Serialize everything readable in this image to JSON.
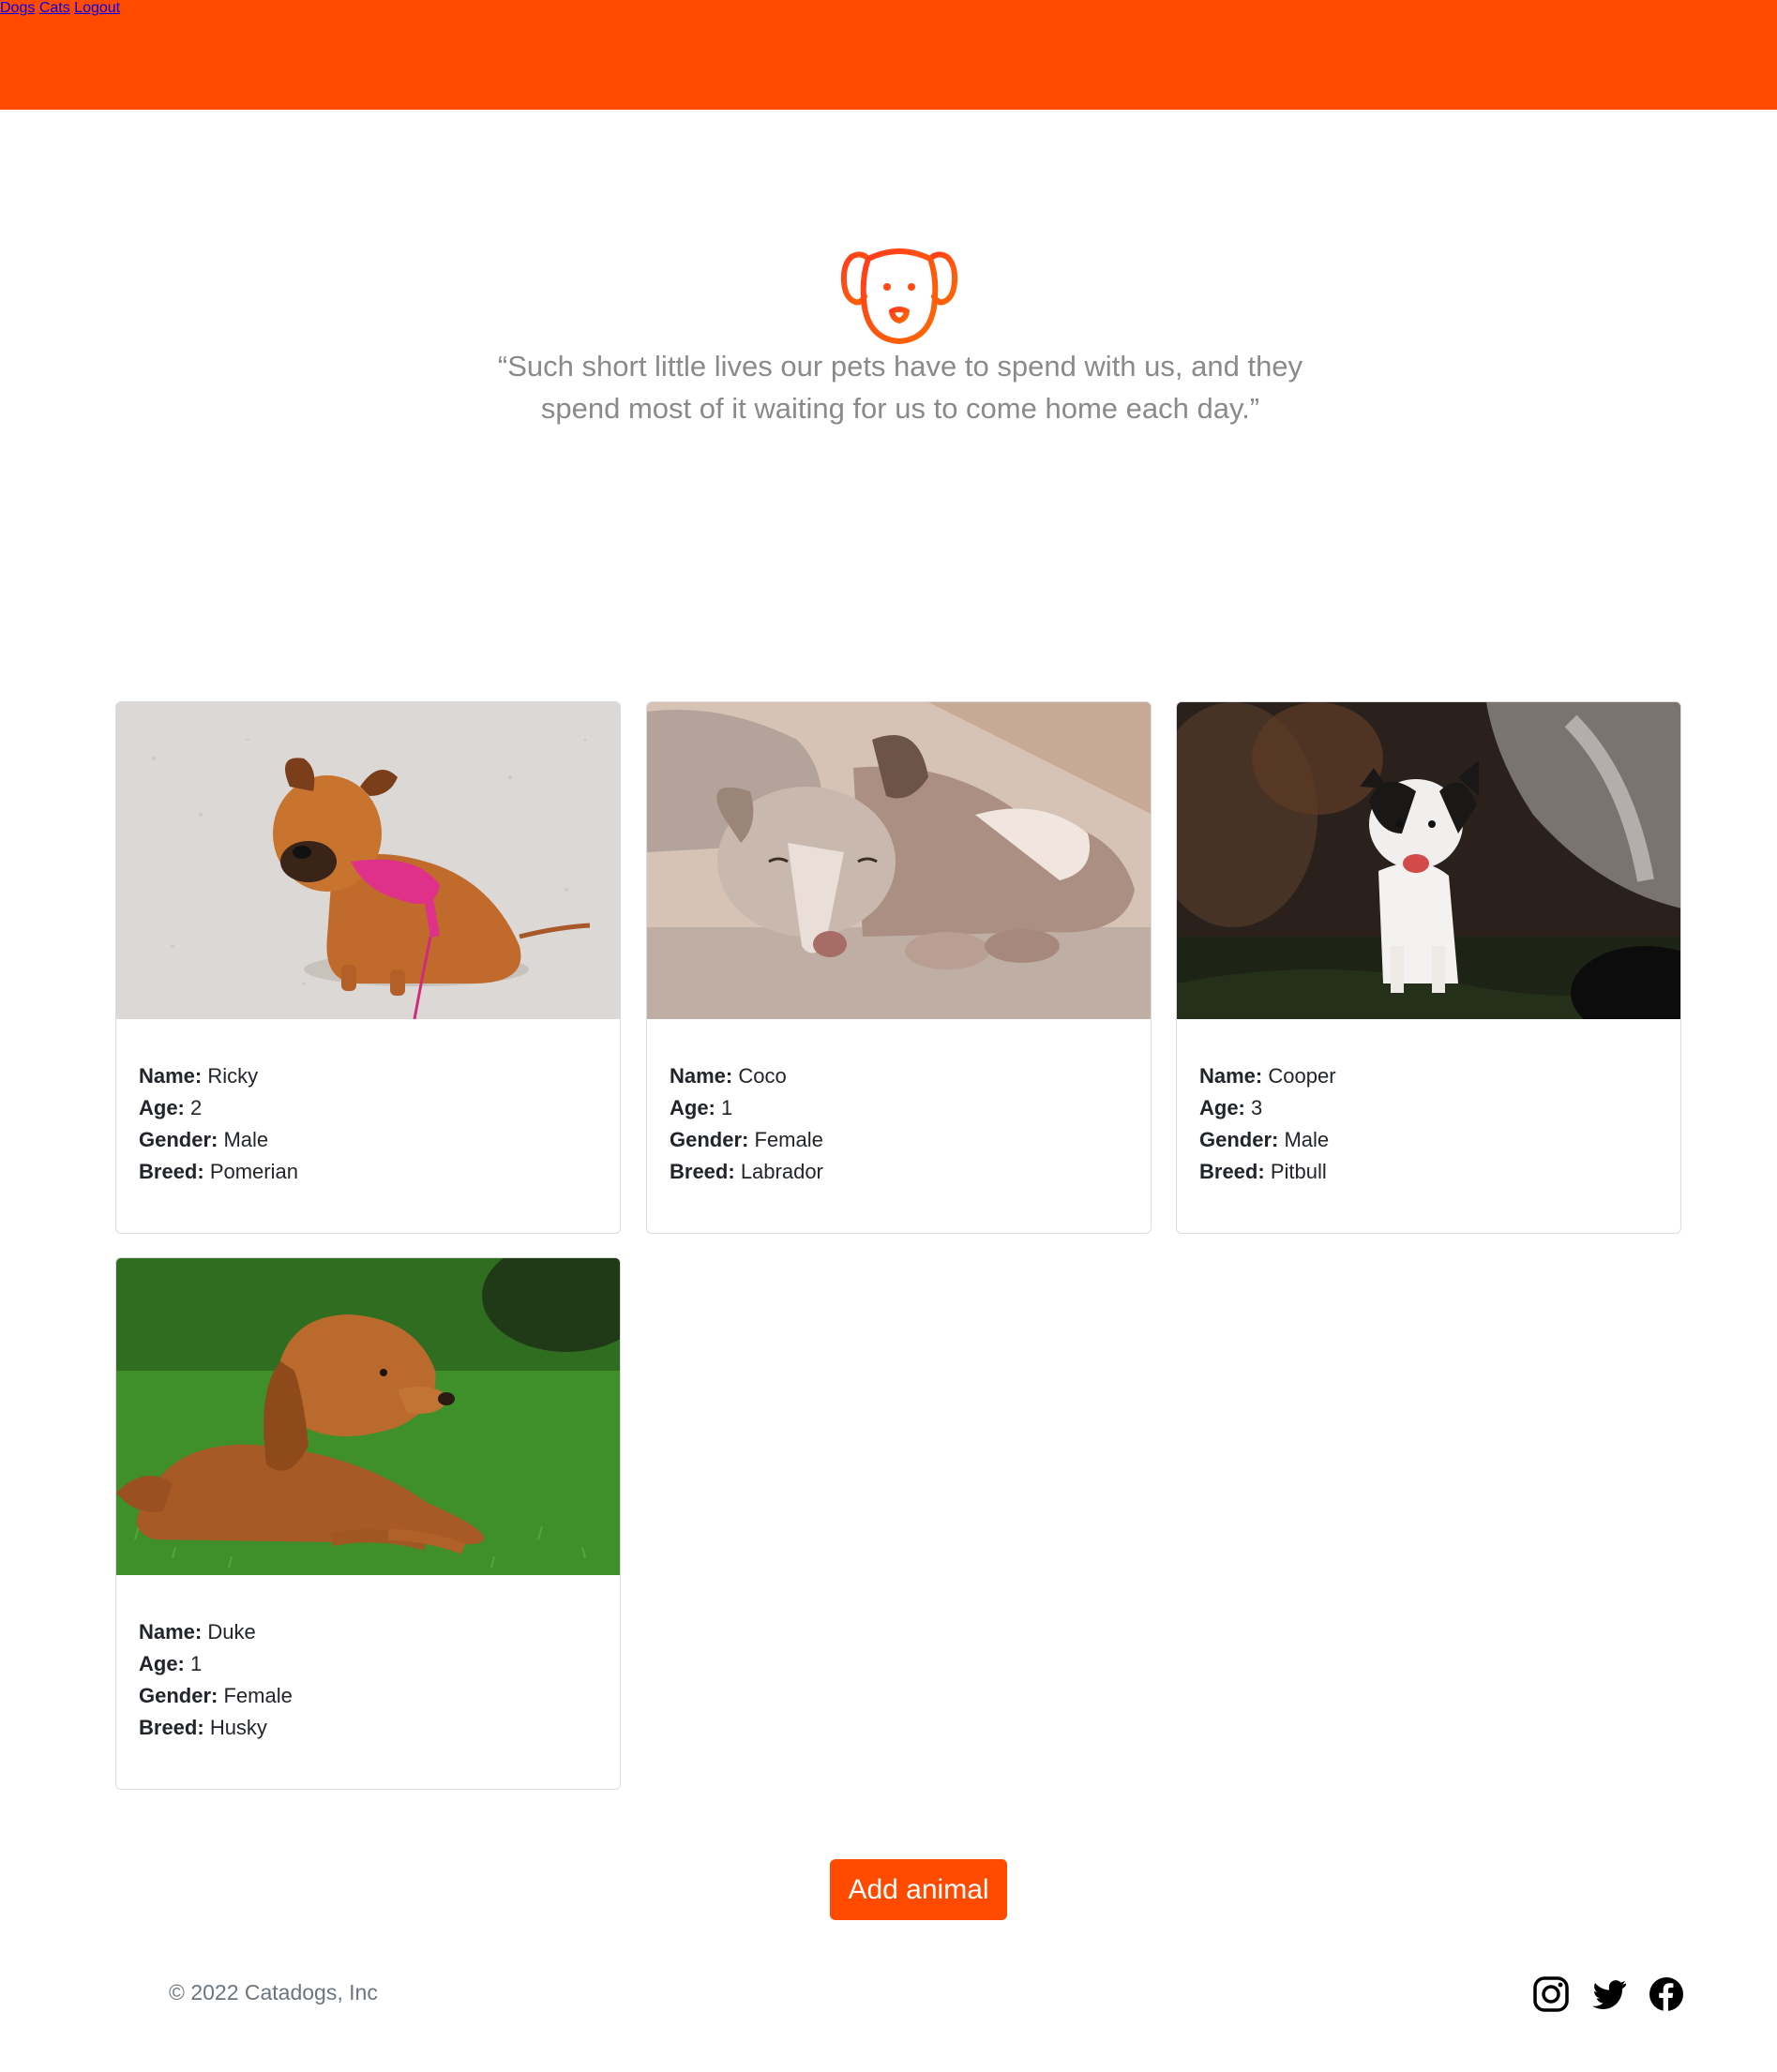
{
  "header": {
    "nav": [
      {
        "label": "Dogs"
      },
      {
        "label": "Cats"
      },
      {
        "label": "Logout"
      }
    ]
  },
  "hero": {
    "icon": "dog-face-icon",
    "quote": "“Such short little lives our pets have to spend with us, and they spend most of it waiting for us to come home each day.”"
  },
  "labels": {
    "name": "Name:",
    "age": "Age:",
    "gender": "Gender:",
    "breed": "Breed:"
  },
  "animals": [
    {
      "name": "Ricky",
      "age": "2",
      "gender": "Male",
      "breed": "Pomerian"
    },
    {
      "name": "Coco",
      "age": "1",
      "gender": "Female",
      "breed": "Labrador"
    },
    {
      "name": "Cooper",
      "age": "3",
      "gender": "Male",
      "breed": "Pitbull"
    },
    {
      "name": "Duke",
      "age": "1",
      "gender": "Female",
      "breed": "Husky"
    }
  ],
  "actions": {
    "add_label": "Add animal"
  },
  "footer": {
    "copyright": "© 2022 Catadogs, Inc",
    "social_icons": [
      "instagram-icon",
      "twitter-icon",
      "facebook-icon"
    ]
  },
  "colors": {
    "accent": "#ff4a00",
    "text": "#212529",
    "muted": "#8a8a8a"
  }
}
